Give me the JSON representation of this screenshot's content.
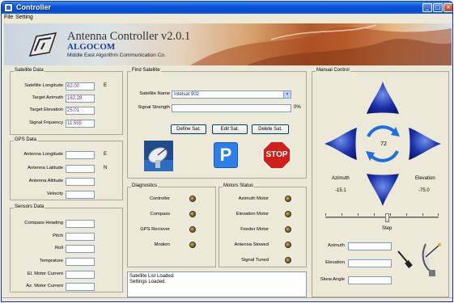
{
  "window": {
    "title": "Controller"
  },
  "menu": [
    "File",
    "Setting"
  ],
  "banner": {
    "title": "Antenna Controller v2.0.1",
    "company": "ALGOCOM",
    "subtitle": "Middle East Algorithm Communication Co."
  },
  "satellite_data": {
    "label": "Satellite Data",
    "rows": [
      {
        "label": "Satellite Longitude",
        "value": "62.00",
        "unit": "E"
      },
      {
        "label": "Target Azimuth",
        "value": "162.28",
        "unit": ""
      },
      {
        "label": "Target Elevation",
        "value": "25.01",
        "unit": ""
      },
      {
        "label": "Signal Frquency",
        "value": "11.555",
        "unit": ""
      }
    ]
  },
  "gps_data": {
    "label": "GPS Data",
    "rows": [
      {
        "label": "Antenna Longitude",
        "value": "",
        "unit": "E"
      },
      {
        "label": "Antenna Latitude",
        "value": "",
        "unit": "N"
      },
      {
        "label": "Antenna Altitude",
        "value": "",
        "unit": ""
      },
      {
        "label": "Velocity",
        "value": "",
        "unit": ""
      }
    ]
  },
  "sensors_data": {
    "label": "Sensors Data",
    "rows": [
      {
        "label": "Compass Heading",
        "value": ""
      },
      {
        "label": "Pitch",
        "value": ""
      },
      {
        "label": "Roll",
        "value": ""
      },
      {
        "label": "Temprature",
        "value": ""
      },
      {
        "label": "El. Motor Current",
        "value": ""
      },
      {
        "label": "Az. Motor Current",
        "value": ""
      }
    ]
  },
  "find_satellite": {
    "label": "Find Satellite",
    "satellite_name_label": "Satellite Name",
    "satellite_name_value": "Intelsat 902",
    "signal_strength_label": "Signal Strength",
    "signal_strength_percent": 0,
    "signal_strength_text": "0%",
    "buttons": {
      "define": "Define Sat.",
      "edit": "Edit Sat.",
      "delete": "Delete Sat."
    },
    "park_label": "P",
    "stop_label": "STOP"
  },
  "diagnostics": {
    "label": "Diagnostics",
    "items": [
      "Controller",
      "Compass",
      "GPS Reciever",
      "Modem"
    ]
  },
  "motors_status": {
    "label": "Motors Status",
    "items": [
      "Azimuth Motor",
      "Elevation Motor",
      "Feeder Motor",
      "Antenna Stowed",
      "Signal Tuned"
    ]
  },
  "log": [
    "Satellite List Loaded.",
    "Settings Loaded."
  ],
  "manual_control": {
    "label": "Manual Control",
    "center_value": "72",
    "azimuth_label": "Azimuth",
    "azimuth_value": "-15.1",
    "elevation_label": "Elevation",
    "elevation_value": "-75.0",
    "step_label": "Step",
    "step_position_fraction": 0.55,
    "fields": [
      {
        "label": "Azimuth",
        "value": ""
      },
      {
        "label": "Elevation",
        "value": ""
      },
      {
        "label": "Skew Angle",
        "value": ""
      }
    ]
  },
  "colors": {
    "arrow_blue": "#1a2fa8",
    "value_purple": "#6a2fa0",
    "stop_red": "#d0201a",
    "park_blue": "#2d7ee8"
  }
}
